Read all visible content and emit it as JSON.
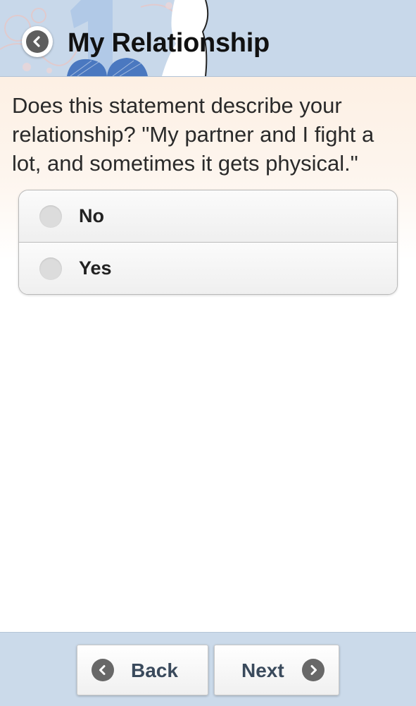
{
  "header": {
    "title": "My Relationship",
    "back_icon": "chevron-left-circle-icon",
    "colors": {
      "bar": "#c8d8ea",
      "art_blue": "#4a78c0",
      "art_light_blue": "#a9c4e6"
    }
  },
  "question": {
    "text": "Does this statement describe your relationship? \"My partner and I fight a lot, and sometimes it gets physical.\""
  },
  "options": [
    {
      "label": "No",
      "selected": false
    },
    {
      "label": "Yes",
      "selected": false
    }
  ],
  "footer": {
    "back_label": "Back",
    "back_icon": "chevron-left-circle-icon",
    "next_label": "Next",
    "next_icon": "chevron-right-circle-icon"
  }
}
